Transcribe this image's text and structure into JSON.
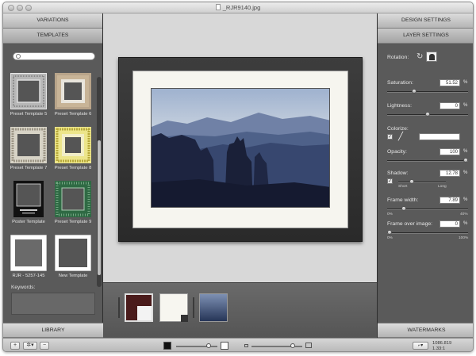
{
  "window": {
    "title": "_RJR9140.jpg"
  },
  "left_panel": {
    "variations_header": "VARIATIONS",
    "templates_header": "TEMPLATES",
    "search": {
      "placeholder": "",
      "value": ""
    },
    "templates": [
      {
        "label": "Preset Template 5"
      },
      {
        "label": "Preset Template 6"
      },
      {
        "label": "Preset Template 7"
      },
      {
        "label": "Preset Template 8"
      },
      {
        "label": "Poster Template"
      },
      {
        "label": "Preset Template 9"
      },
      {
        "label": "RJR - 5257-145"
      },
      {
        "label": "New Template"
      }
    ],
    "keywords_label": "Keywords:",
    "library_header": "LIBRARY"
  },
  "right_panel": {
    "design_settings_header": "DESIGN SETTINGS",
    "layer_settings_header": "LAYER SETTINGS",
    "rotation_label": "Rotation:",
    "saturation": {
      "label": "Saturation:",
      "value": "51.52",
      "unit": "%",
      "fraction": 0.32
    },
    "lightness": {
      "label": "Lightness:",
      "value": "0",
      "unit": "%",
      "fraction": 0.5
    },
    "colorize": {
      "label": "Colorize:",
      "checked": true,
      "color": "#ffffff"
    },
    "opacity": {
      "label": "Opacity:",
      "value": "100",
      "unit": "%",
      "fraction": 1.0
    },
    "shadow": {
      "label": "Shadow:",
      "checked": true,
      "value": "12.78",
      "unit": "%",
      "fraction": 0.25,
      "min_label": "Short",
      "max_label": "Long"
    },
    "frame_width": {
      "label": "Frame width:",
      "value": "7.89",
      "unit": "%",
      "fraction": 0.19,
      "min_label": "0%",
      "max_label": "40%"
    },
    "frame_over_image": {
      "label": "Frame over image:",
      "value": "0",
      "unit": "%",
      "fraction": 0.0,
      "min_label": "0%",
      "max_label": "100%"
    },
    "watermarks_header": "WATERMARKS"
  },
  "bottom_bar": {
    "add_label": "+",
    "action_label": "✲▾",
    "remove_label": "−",
    "dimensions_line1": "1086.819",
    "dimensions_line2": "1.33:1"
  },
  "colors": {
    "panel_bg": "#5a5a5a",
    "frame_color": "#2f2f2f",
    "mat_color": "#f6f5ef"
  }
}
